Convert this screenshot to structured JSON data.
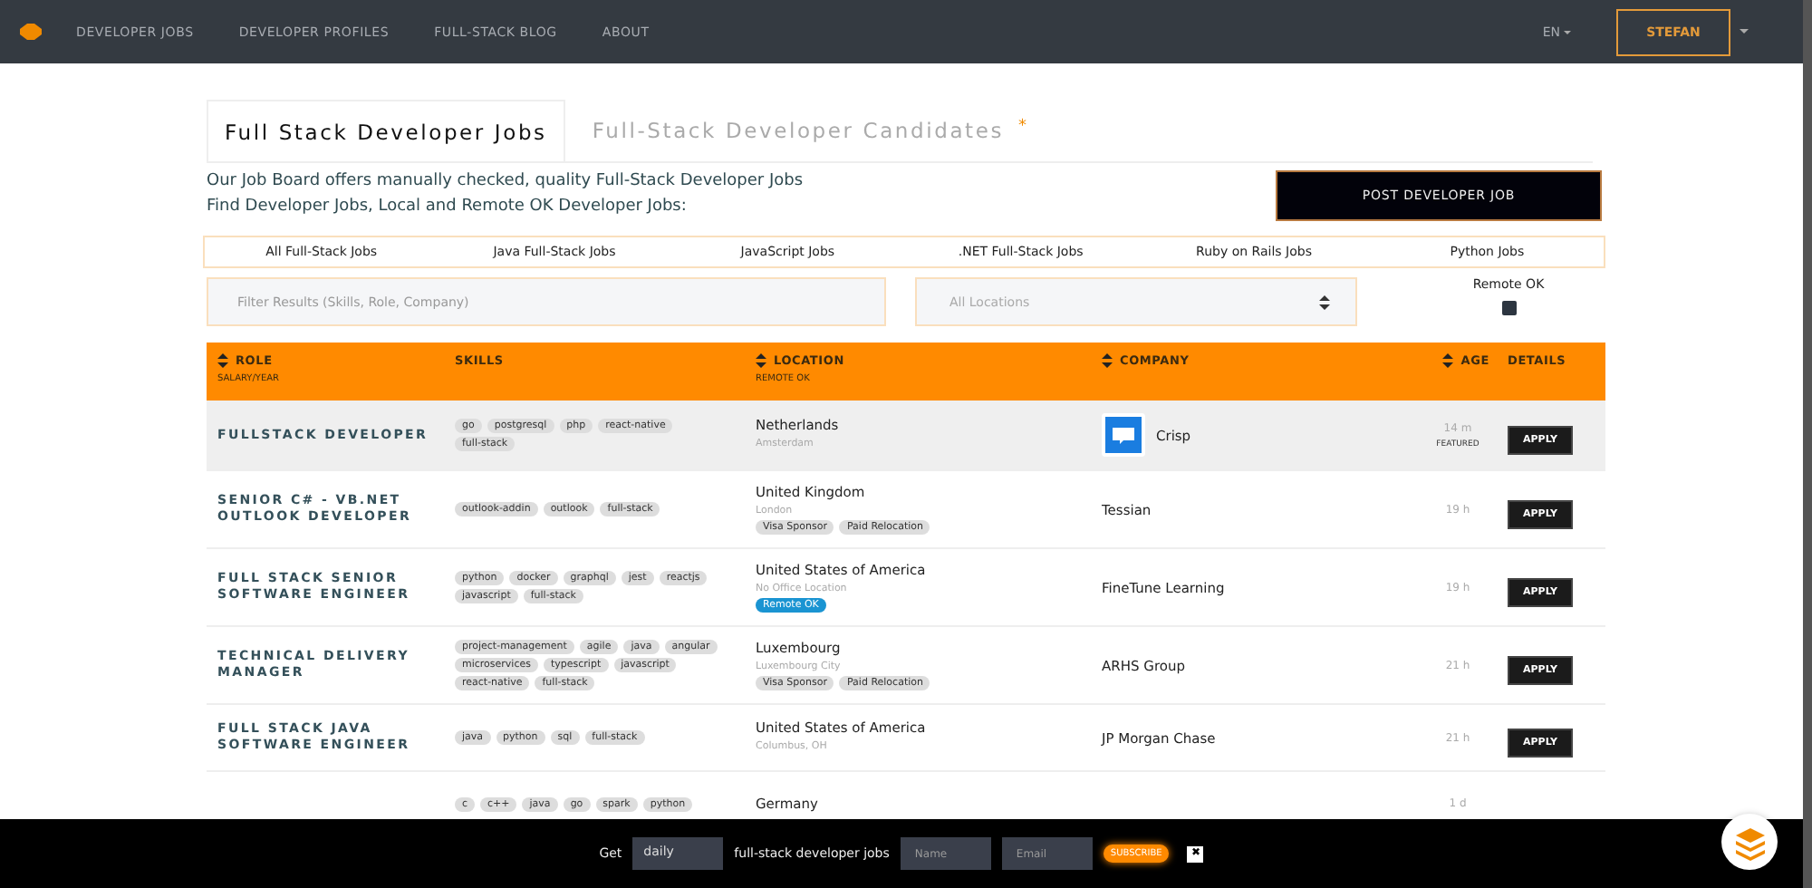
{
  "nav": {
    "links": [
      {
        "label": "DEVELOPER JOBS",
        "selected": false
      },
      {
        "label": "DEVELOPER PROFILES",
        "selected": false
      },
      {
        "label": "FULL-STACK BLOG",
        "selected": false
      },
      {
        "label": "ABOUT",
        "selected": false
      }
    ],
    "language": "EN",
    "user": "STEFAN"
  },
  "tabs": [
    {
      "label": "Full Stack Developer Jobs",
      "selected": true
    },
    {
      "label": "Full-Stack Developer Candidates",
      "selected": false,
      "badge": "*"
    }
  ],
  "intro": [
    "Our Job Board offers manually checked, quality Full-Stack Developer Jobs",
    "Find Developer Jobs, Local and Remote OK Developer Jobs:"
  ],
  "post_button": "POST DEVELOPER JOB",
  "categories": [
    "All Full-Stack Jobs",
    "Java Full-Stack Jobs",
    "JavaScript Jobs",
    ".NET Full-Stack Jobs",
    "Ruby on Rails Jobs",
    "Python Jobs"
  ],
  "filters": {
    "search_placeholder": "Filter Results (Skills, Role, Company)",
    "location_placeholder": "All Locations",
    "remote_label": "Remote OK",
    "remote_checked": false
  },
  "table": {
    "columns": [
      {
        "label": "ROLE",
        "sub": "SALARY/YEAR",
        "sortable": true
      },
      {
        "label": "SKILLS",
        "sortable": false
      },
      {
        "label": "LOCATION",
        "sub": "REMOTE OK",
        "sortable": true
      },
      {
        "label": "COMPANY",
        "sortable": true
      },
      {
        "label": "AGE",
        "sortable": true
      },
      {
        "label": "DETAILS",
        "sortable": false
      }
    ],
    "rows": [
      {
        "role": "FULLSTACK DEVELOPER",
        "skills": [
          "go",
          "postgresql",
          "php",
          "react-native",
          "full-stack"
        ],
        "country": "Netherlands",
        "city": "Amsterdam",
        "tags": [],
        "company": "Crisp",
        "logo": true,
        "age": "14 m",
        "note": "FEATURED",
        "featured": true,
        "apply": "APPLY"
      },
      {
        "role": "SENIOR C# - VB.NET OUTLOOK DEVELOPER",
        "skills": [
          "outlook-addin",
          "outlook",
          "full-stack"
        ],
        "country": "United Kingdom",
        "city": "London",
        "tags": [
          {
            "label": "Visa Sponsor",
            "kind": "plain"
          },
          {
            "label": "Paid Relocation",
            "kind": "plain"
          }
        ],
        "company": "Tessian",
        "logo": false,
        "age": "19 h",
        "featured": false,
        "apply": "APPLY"
      },
      {
        "role": "FULL STACK SENIOR SOFTWARE ENGINEER",
        "skills": [
          "python",
          "docker",
          "graphql",
          "jest",
          "reactjs",
          "javascript",
          "full-stack"
        ],
        "country": "United States of America",
        "city": "No Office Location",
        "tags": [
          {
            "label": "Remote OK",
            "kind": "remote"
          }
        ],
        "company": "FineTune Learning",
        "logo": false,
        "age": "19 h",
        "featured": false,
        "apply": "APPLY"
      },
      {
        "role": "TECHNICAL DELIVERY MANAGER",
        "skills": [
          "project-management",
          "agile",
          "java",
          "angular",
          "microservices",
          "typescript",
          "javascript",
          "react-native",
          "full-stack"
        ],
        "country": "Luxembourg",
        "city": "Luxembourg City",
        "tags": [
          {
            "label": "Visa Sponsor",
            "kind": "plain"
          },
          {
            "label": "Paid Relocation",
            "kind": "plain"
          }
        ],
        "company": "ARHS Group",
        "logo": false,
        "age": "21 h",
        "featured": false,
        "apply": "APPLY"
      },
      {
        "role": "FULL STACK JAVA SOFTWARE ENGINEER",
        "skills": [
          "java",
          "python",
          "sql",
          "full-stack"
        ],
        "country": "United States of America",
        "city": "Columbus, OH",
        "tags": [],
        "company": "JP Morgan Chase",
        "logo": false,
        "age": "21 h",
        "featured": false,
        "apply": "APPLY"
      },
      {
        "skills": [
          "c",
          "c++",
          "java",
          "go",
          "spark",
          "python"
        ],
        "country": "Germany",
        "tags": [],
        "logo": false,
        "age": "1 d",
        "featured": false
      }
    ]
  },
  "subscribe": {
    "prefix": "Get",
    "frequency": "daily",
    "middle": "full-stack developer jobs",
    "name_placeholder": "Name",
    "email_placeholder": "Email",
    "button": "SUBSCRIBE",
    "close": "✖"
  }
}
